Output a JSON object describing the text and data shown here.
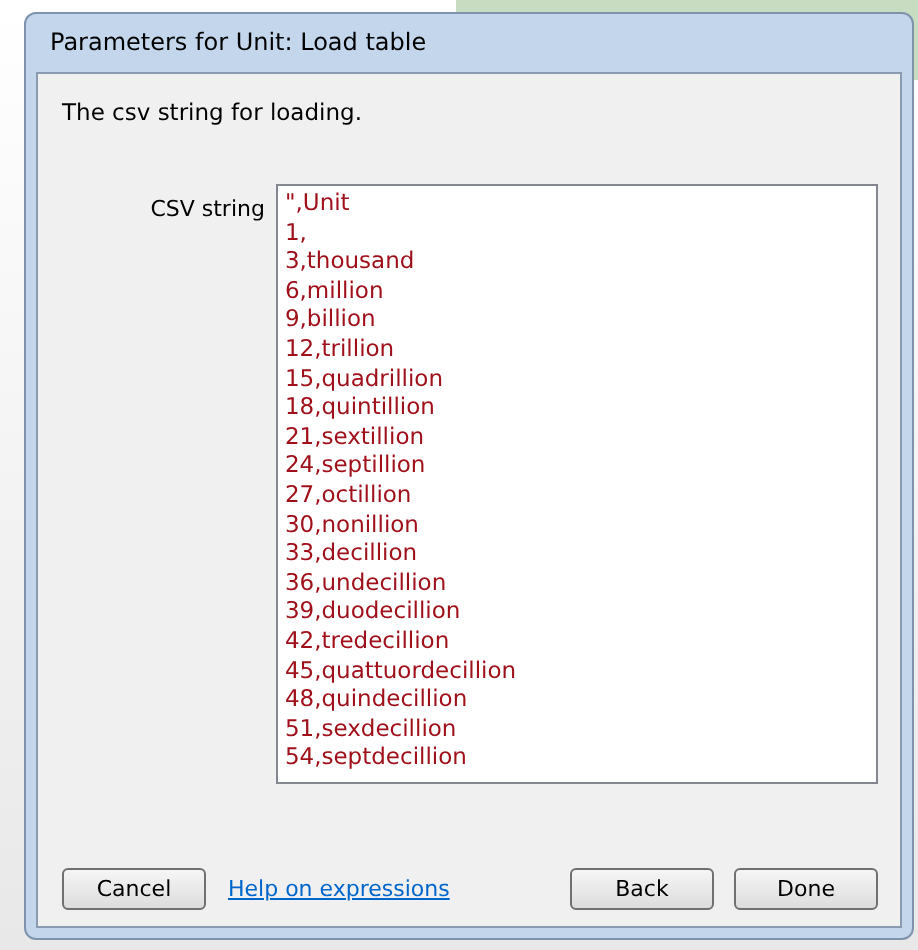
{
  "window": {
    "title": "Parameters for Unit: Load table"
  },
  "description": "The csv string for loading.",
  "field": {
    "label": "CSV string",
    "lines": [
      "\",Unit",
      "1,",
      "3,thousand",
      "6,million",
      "9,billion",
      "12,trillion",
      "15,quadrillion",
      "18,quintillion",
      "21,sextillion",
      "24,septillion",
      "27,octillion",
      "30,nonillion",
      "33,decillion",
      "36,undecillion",
      "39,duodecillion",
      "42,tredecillion",
      "45,quattuordecillion",
      "48,quindecillion",
      "51,sexdecillion",
      "54,septdecillion"
    ]
  },
  "buttons": [
    {
      "label": "Cancel",
      "kind": "button"
    },
    {
      "label": "Help on expressions",
      "kind": "link"
    },
    {
      "label": "Back",
      "kind": "button"
    },
    {
      "label": "Done",
      "kind": "button"
    }
  ]
}
